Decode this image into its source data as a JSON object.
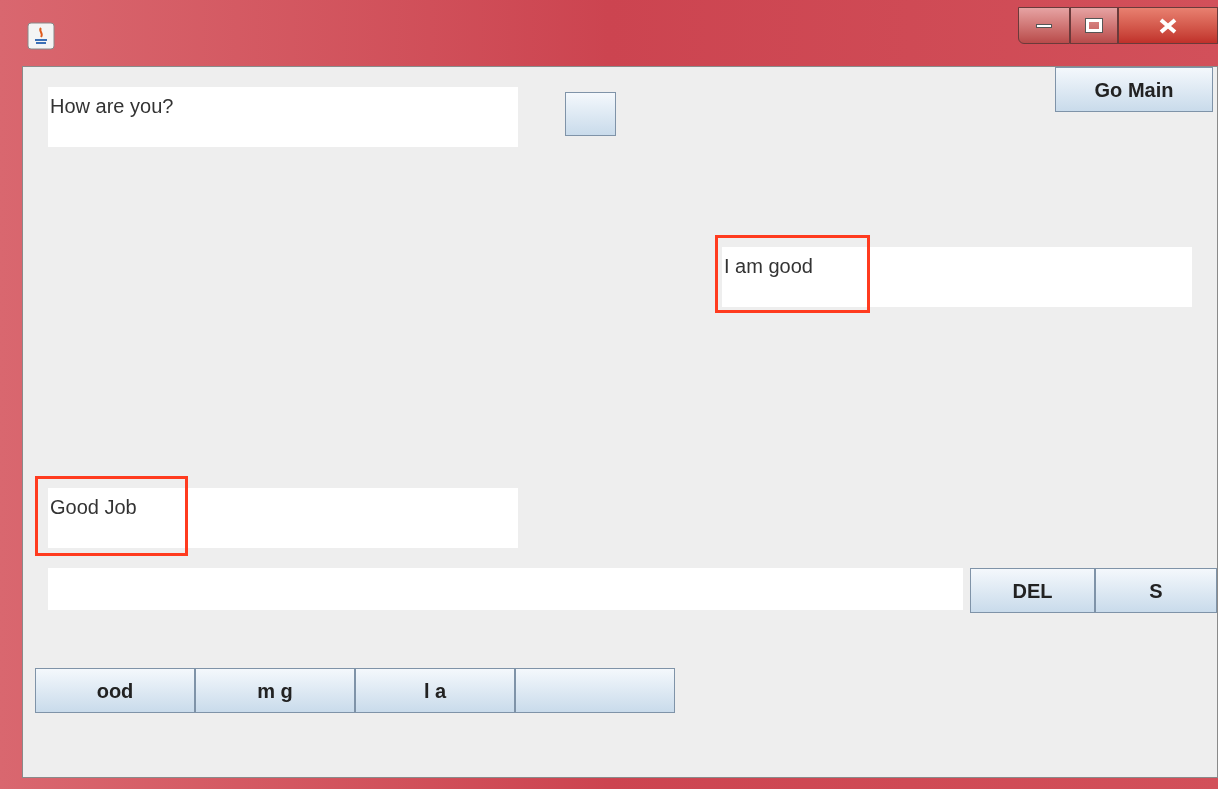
{
  "go_main_button": "Go Main",
  "messages": [
    {
      "text": "How are you?",
      "kind": "incoming",
      "highlighted": false
    },
    {
      "text": "I am good",
      "kind": "outgoing",
      "highlighted": true
    },
    {
      "text": "Good Job",
      "kind": "incoming",
      "highlighted": true
    }
  ],
  "input_buttons": [
    "DEL",
    "S"
  ],
  "letter_buttons": [
    {
      "kind": "text",
      "label": "ood"
    },
    {
      "kind": "text",
      "label": "m g"
    },
    {
      "kind": "text",
      "label": "l a"
    },
    {
      "kind": "blank"
    }
  ]
}
